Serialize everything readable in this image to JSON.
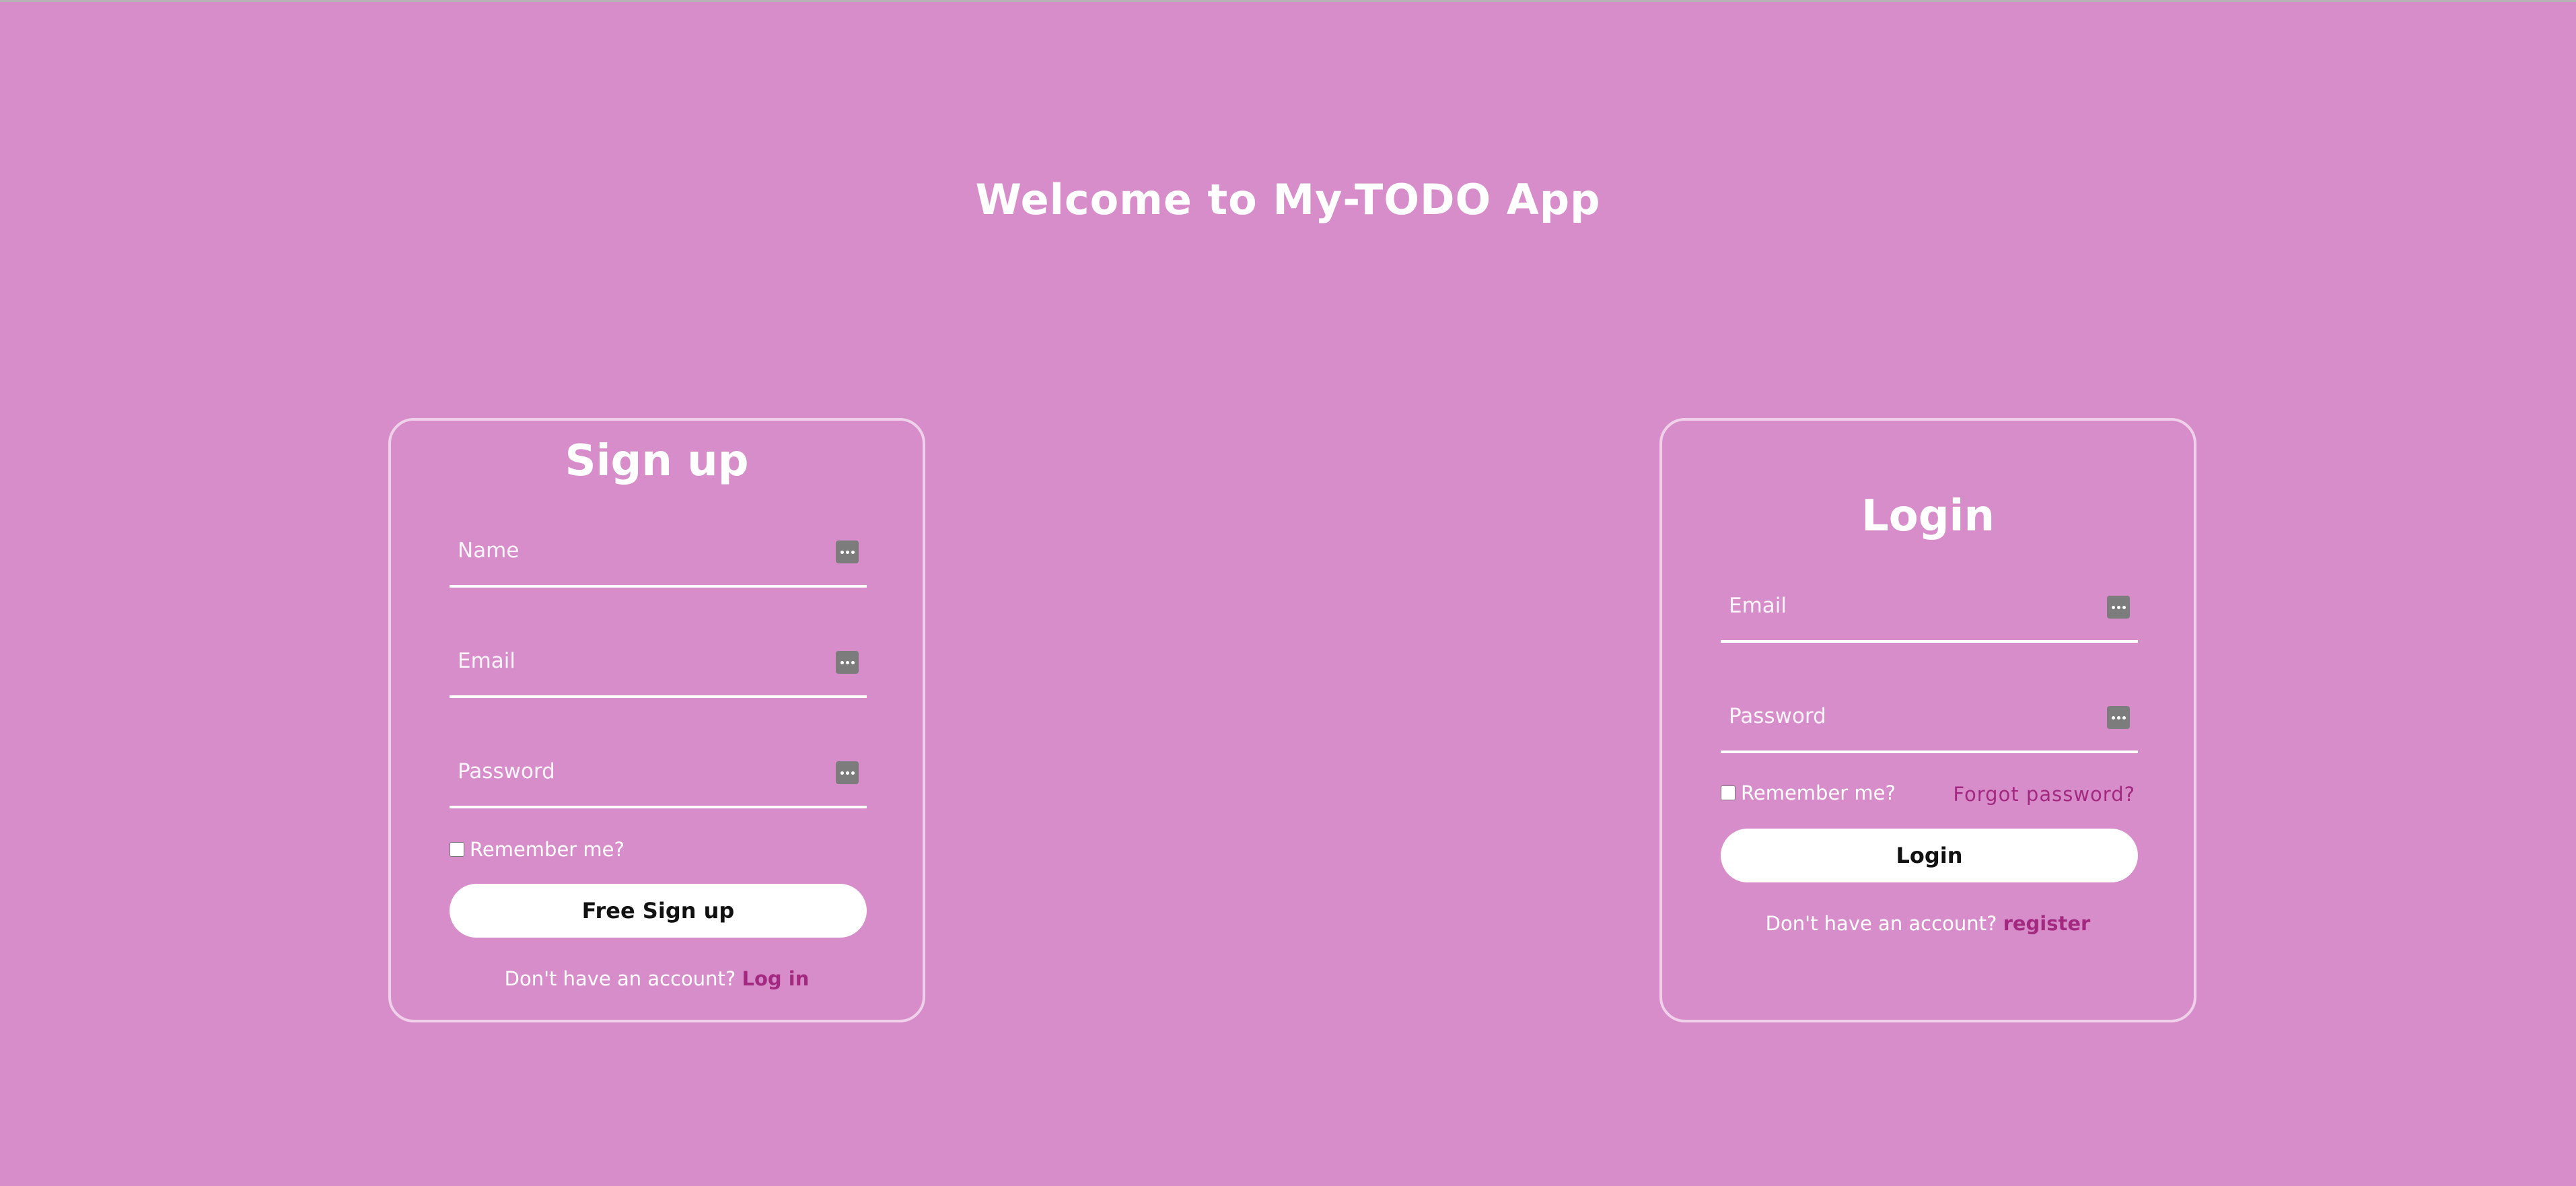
{
  "page": {
    "title": "Welcome to My-TODO App",
    "background_color": "#d78dca",
    "accent_link_color": "#a3287f"
  },
  "signup": {
    "title": "Sign up",
    "name_placeholder": "Name",
    "email_placeholder": "Email",
    "password_placeholder": "Password",
    "remember_label": "Remember me?",
    "submit_label": "Free Sign up",
    "switch_text": "Don't have an account?",
    "switch_link": "Log in",
    "field_icon": "password-manager-icon"
  },
  "login": {
    "title": "Login",
    "email_placeholder": "Email",
    "password_placeholder": "Password",
    "remember_label": "Remember me?",
    "forgot_link": "Forgot password?",
    "submit_label": "Login",
    "switch_text": "Don't have an account?",
    "switch_link": "register",
    "field_icon": "password-manager-icon"
  }
}
